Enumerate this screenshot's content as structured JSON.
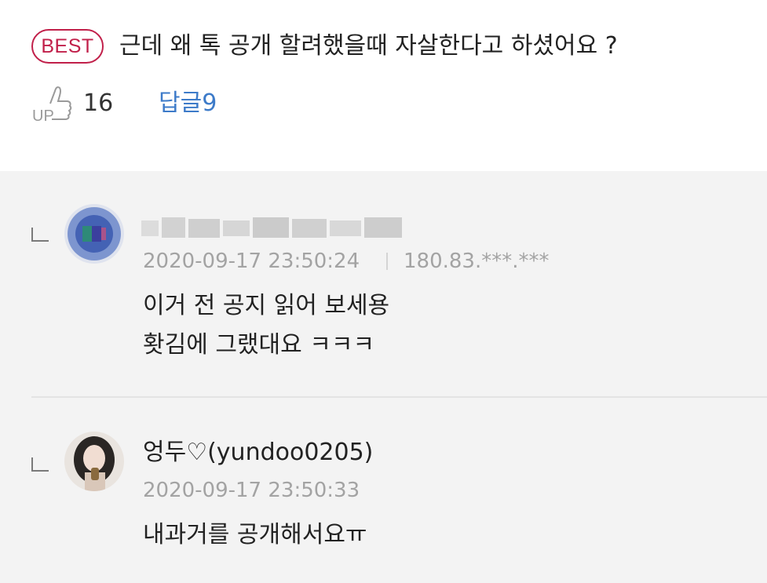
{
  "best_comment": {
    "badge": "BEST",
    "text": "근데 왜 톡 공개 할려했을때 자살한다고 하셨어요 ?",
    "up_icon_label": "UP",
    "up_count": "16",
    "reply_link": "답글9"
  },
  "replies": [
    {
      "nickname_blurred": true,
      "date": "2020-09-17 23:50:24",
      "ip": "180.83.***.***",
      "lines": [
        "이거 전 공지 읽어 보세용",
        "홧김에 그랬대요 ㅋㅋㅋ"
      ]
    },
    {
      "nickname": "엉두♡(yundoo0205)",
      "date": "2020-09-17 23:50:33",
      "lines": [
        "내과거를 공개해서요ㅠ"
      ]
    }
  ],
  "colors": {
    "best_badge": "#c1204a",
    "reply_link": "#3d7bc9",
    "meta_text": "#a3a3a3",
    "reply_background": "#f3f3f3"
  }
}
